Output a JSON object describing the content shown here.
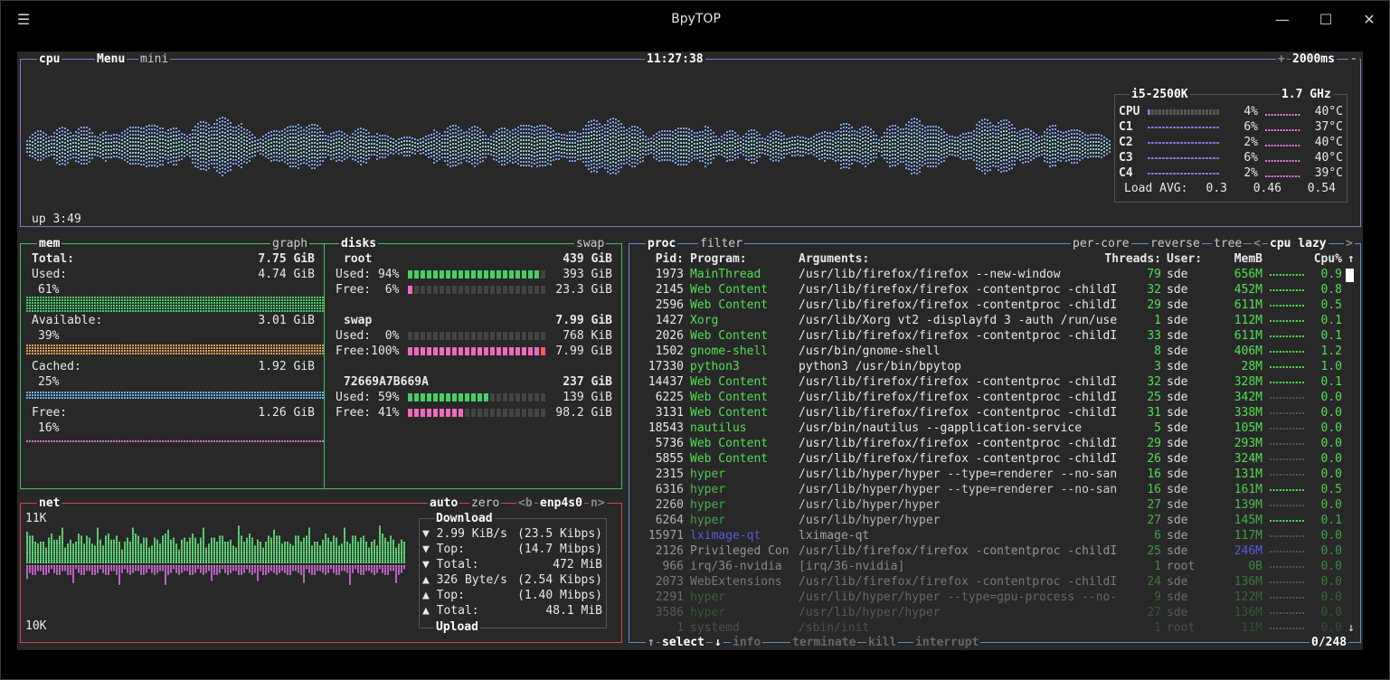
{
  "window": {
    "title": "BpyTOP",
    "menu_icon": "hamburger-icon",
    "minimize_icon": "minimize-icon",
    "maximize_icon": "maximize-icon",
    "close_icon": "close-icon"
  },
  "cpu": {
    "title": "cpu",
    "menu": "Menu",
    "mini": "mini",
    "clock": "11:27:38",
    "plus": "+",
    "interval": "2000ms",
    "minus": "-",
    "uptime": "up 3:49",
    "model": "i5-2500K",
    "freq": "1.7 GHz",
    "cores": [
      {
        "name": "CPU",
        "pct": "4%",
        "temp": "40°C",
        "level": 0.04
      },
      {
        "name": "C1",
        "pct": "6%",
        "temp": "37°C",
        "level": 0.06
      },
      {
        "name": "C2",
        "pct": "2%",
        "temp": "40°C",
        "level": 0.02
      },
      {
        "name": "C3",
        "pct": "6%",
        "temp": "40°C",
        "level": 0.06
      },
      {
        "name": "C4",
        "pct": "2%",
        "temp": "39°C",
        "level": 0.02
      }
    ],
    "load_label": "Load AVG:",
    "load": [
      "0.3",
      "0.46",
      "0.54"
    ]
  },
  "mem": {
    "title": "mem",
    "graph": "graph",
    "total_label": "Total:",
    "total": "7.75 GiB",
    "used_label": "Used:",
    "used": "4.74 GiB",
    "used_pct": "61%",
    "avail_label": "Available:",
    "avail": "3.01 GiB",
    "avail_pct": "39%",
    "cached_label": "Cached:",
    "cached": "1.92 GiB",
    "cached_pct": "25%",
    "free_label": "Free:",
    "free": "1.26 GiB",
    "free_pct": "16%"
  },
  "disks": {
    "title": "disks",
    "swap_tab": "swap",
    "root_name": "root",
    "root_total": "439 GiB",
    "root_used_label": "Used: 94%",
    "root_used": "393 GiB",
    "root_free_label": "Free:  6%",
    "root_free": "23.3 GiB",
    "root_used_level": 0.94,
    "root_free_level": 0.06,
    "swap_name": "swap",
    "swap_total": "7.99 GiB",
    "swap_used_label": "Used:  0%",
    "swap_used": "768 KiB",
    "swap_free_label": "Free:100%",
    "swap_free": "7.99 GiB",
    "swap_used_level": 0.0,
    "swap_free_level": 1.0,
    "d3_name": "72669A7B669A",
    "d3_total": "237 GiB",
    "d3_used_label": "Used: 59%",
    "d3_used": "139 GiB",
    "d3_free_label": "Free: 41%",
    "d3_free": "98.2 GiB",
    "d3_used_level": 0.59,
    "d3_free_level": 0.41
  },
  "net": {
    "title": "net",
    "auto": "auto",
    "zero": "zero",
    "prev": "<b",
    "iface": "enp4s0",
    "next": "n>",
    "top_scale": "11K",
    "bottom_scale": "10K",
    "download": "Download",
    "upload": "Upload",
    "dl_rate": "▼ 2.99 KiB/s",
    "dl_rate_bits": "(23.5 Kibps)",
    "dl_top_label": "▼ Top:",
    "dl_top": "(14.7 Mibps)",
    "dl_total_label": "▼ Total:",
    "dl_total": "472 MiB",
    "ul_rate": "▲ 326 Byte/s",
    "ul_rate_bits": "(2.54 Kibps)",
    "ul_top_label": "▲ Top:",
    "ul_top": "(1.40 Mibps)",
    "ul_total_label": "▲ Total:",
    "ul_total": "48.1 MiB"
  },
  "proc": {
    "title": "proc",
    "filter": "filter",
    "per_core": "per-core",
    "reverse": "reverse",
    "tree": "tree",
    "sort_prev": "<",
    "sort": "cpu lazy",
    "sort_next": ">",
    "headers": {
      "pid": "Pid:",
      "program": "Program:",
      "args": "Arguments:",
      "threads": "Threads:",
      "user": "User:",
      "mem": "MemB",
      "cpu": "Cpu%",
      "arrow": "↑"
    },
    "rows": [
      {
        "pid": "1973",
        "program": "MainThread",
        "args": "/usr/lib/firefox/firefox --new-window",
        "threads": "79",
        "user": "sde",
        "mem": "656M",
        "cpu": "0.9"
      },
      {
        "pid": "2145",
        "program": "Web Content",
        "args": "/usr/lib/firefox/firefox -contentproc -childI",
        "threads": "32",
        "user": "sde",
        "mem": "452M",
        "cpu": "0.8"
      },
      {
        "pid": "2596",
        "program": "Web Content",
        "args": "/usr/lib/firefox/firefox -contentproc -childI",
        "threads": "29",
        "user": "sde",
        "mem": "611M",
        "cpu": "0.5"
      },
      {
        "pid": "1427",
        "program": "Xorg",
        "args": "/usr/lib/Xorg vt2 -displayfd 3 -auth /run/use",
        "threads": "1",
        "user": "sde",
        "mem": "112M",
        "cpu": "0.1"
      },
      {
        "pid": "2026",
        "program": "Web Content",
        "args": "/usr/lib/firefox/firefox -contentproc -childI",
        "threads": "33",
        "user": "sde",
        "mem": "611M",
        "cpu": "0.1"
      },
      {
        "pid": "1502",
        "program": "gnome-shell",
        "args": "/usr/bin/gnome-shell",
        "threads": "8",
        "user": "sde",
        "mem": "406M",
        "cpu": "1.2"
      },
      {
        "pid": "17330",
        "program": "python3",
        "args": "python3 /usr/bin/bpytop",
        "threads": "3",
        "user": "sde",
        "mem": "28M",
        "cpu": "1.0"
      },
      {
        "pid": "14437",
        "program": "Web Content",
        "args": "/usr/lib/firefox/firefox -contentproc -childI",
        "threads": "32",
        "user": "sde",
        "mem": "328M",
        "cpu": "0.1"
      },
      {
        "pid": "6225",
        "program": "Web Content",
        "args": "/usr/lib/firefox/firefox -contentproc -childI",
        "threads": "25",
        "user": "sde",
        "mem": "342M",
        "cpu": "0.0"
      },
      {
        "pid": "3131",
        "program": "Web Content",
        "args": "/usr/lib/firefox/firefox -contentproc -childI",
        "threads": "31",
        "user": "sde",
        "mem": "338M",
        "cpu": "0.0"
      },
      {
        "pid": "18543",
        "program": "nautilus",
        "args": "/usr/bin/nautilus --gapplication-service",
        "threads": "5",
        "user": "sde",
        "mem": "105M",
        "cpu": "0.0"
      },
      {
        "pid": "5736",
        "program": "Web Content",
        "args": "/usr/lib/firefox/firefox -contentproc -childI",
        "threads": "29",
        "user": "sde",
        "mem": "293M",
        "cpu": "0.0"
      },
      {
        "pid": "5855",
        "program": "Web Content",
        "args": "/usr/lib/firefox/firefox -contentproc -childI",
        "threads": "26",
        "user": "sde",
        "mem": "324M",
        "cpu": "0.0"
      },
      {
        "pid": "2315",
        "program": "hyper",
        "args": "/usr/lib/hyper/hyper --type=renderer --no-san",
        "threads": "16",
        "user": "sde",
        "mem": "131M",
        "cpu": "0.0"
      },
      {
        "pid": "6316",
        "program": "hyper",
        "args": "/usr/lib/hyper/hyper --type=renderer --no-san",
        "threads": "16",
        "user": "sde",
        "mem": "161M",
        "cpu": "0.5"
      },
      {
        "pid": "2260",
        "program": "hyper",
        "args": "/usr/lib/hyper/hyper",
        "threads": "27",
        "user": "sde",
        "mem": "139M",
        "cpu": "0.0"
      },
      {
        "pid": "6264",
        "program": "hyper",
        "args": "/usr/lib/hyper/hyper",
        "threads": "27",
        "user": "sde",
        "mem": "145M",
        "cpu": "0.1"
      },
      {
        "pid": "15971",
        "program": "lximage-qt",
        "args": "lximage-qt",
        "threads": "6",
        "user": "sde",
        "mem": "117M",
        "cpu": "0.0"
      },
      {
        "pid": "2126",
        "program": "Privileged Con",
        "args": "/usr/lib/firefox/firefox -contentproc -childI",
        "threads": "25",
        "user": "sde",
        "mem": "246M",
        "cpu": "0.0"
      },
      {
        "pid": "966",
        "program": "irq/36-nvidia",
        "args": "[irq/36-nvidia]",
        "threads": "1",
        "user": "root",
        "mem": "0B",
        "cpu": "0.0"
      },
      {
        "pid": "2073",
        "program": "WebExtensions",
        "args": "/usr/lib/firefox/firefox -contentproc -childI",
        "threads": "24",
        "user": "sde",
        "mem": "136M",
        "cpu": "0.0"
      },
      {
        "pid": "2291",
        "program": "hyper",
        "args": "/usr/lib/hyper/hyper --type=gpu-process --no-",
        "threads": "9",
        "user": "sde",
        "mem": "122M",
        "cpu": "0.0"
      },
      {
        "pid": "3586",
        "program": "hyper",
        "args": "/usr/lib/hyper/hyper",
        "threads": "27",
        "user": "sde",
        "mem": "136M",
        "cpu": "0.0"
      },
      {
        "pid": "1",
        "program": "systemd",
        "args": "/sbin/init",
        "threads": "1",
        "user": "root",
        "mem": "11M",
        "cpu": "0.0"
      }
    ],
    "scroll_down": "↓",
    "footer_up": "↑",
    "select": "select",
    "select_down": "↓",
    "info": "info",
    "terminate": "terminate",
    "kill": "kill",
    "interrupt": "interrupt",
    "count": "0/248"
  },
  "colors": {
    "cpu_box": "#8d6fd6",
    "mem_box": "#3cc65a",
    "net_box": "#d4444c",
    "proc_box": "#5d8fd8",
    "green": "#50e050",
    "blue": "#6a5cd8",
    "accent": "#b07ad6",
    "temp": "#e07ad6"
  }
}
